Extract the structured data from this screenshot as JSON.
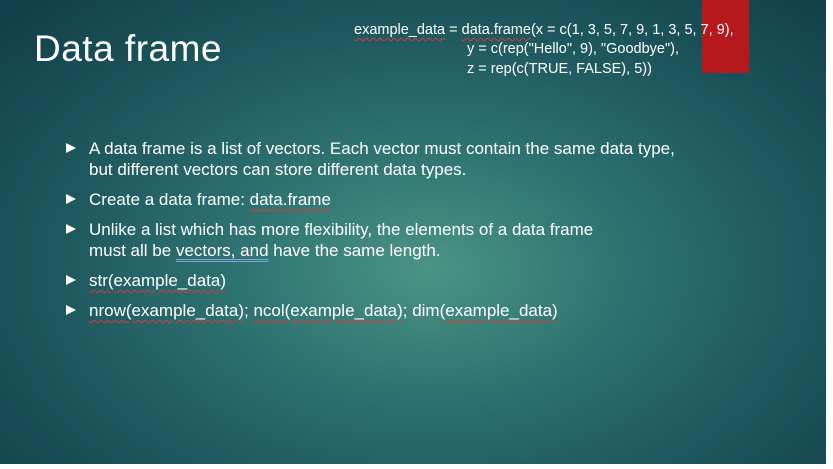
{
  "slide": {
    "title": "Data frame",
    "code": {
      "line1": {
        "var": "example_data",
        "eq": " = ",
        "fn": "data.frame",
        "rest": "(x = c(1, 3, 5, 7, 9, 1, 3, 5, 7, 9),"
      },
      "line2": "y = c(rep(\"Hello\", 9), \"Goodbye\"),",
      "line3": "z = rep(c(TRUE, FALSE), 5))"
    },
    "bullets": {
      "b1": "A data frame is a list of vectors. Each vector must contain the same data type, but different vectors can store different data types.",
      "b2": {
        "prefix": "Create a data frame: ",
        "code": "data.frame"
      },
      "b3": {
        "line1": "Unlike a list which has more flexibility, the elements of a data frame",
        "line2_prefix": "must all be ",
        "line2_marked": "vectors, and",
        "line2_suffix": " have the same length."
      },
      "b4": {
        "fn": "str",
        "arg": "(example_data)"
      },
      "b5": {
        "fn1": "nrow",
        "arg1": "(example_data)",
        "sep1": "; ",
        "fn2": "ncol",
        "arg2": "(example_data)",
        "sep2": "; dim",
        "arg3": "(example_data)"
      }
    }
  },
  "colors": {
    "background_center": "#4b9484",
    "background_edge": "#123f49",
    "accent_red": "#b5191e",
    "text": "#ffffff",
    "spellcheck_red": "#d33b3b",
    "grammar_blue": "#7fa6e0"
  }
}
